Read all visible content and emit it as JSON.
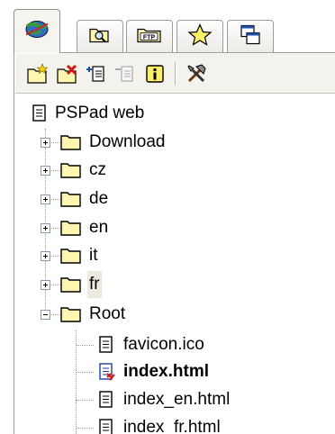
{
  "tabs": [
    {
      "icon": "globe-icon",
      "active": true
    },
    {
      "icon": "folder-search-icon",
      "active": false
    },
    {
      "icon": "ftp-icon",
      "label": "FTP",
      "active": false
    },
    {
      "icon": "star-icon",
      "active": false
    },
    {
      "icon": "windows-icon",
      "active": false
    }
  ],
  "toolbar": {
    "buttons": [
      "new-folder-icon",
      "delete-folder-icon",
      "add-file-icon",
      "remove-file-icon",
      "info-icon",
      "tools-icon"
    ]
  },
  "tree": {
    "root_label": "PSPad web",
    "folders": [
      {
        "label": "Download",
        "expanded": false
      },
      {
        "label": "cz",
        "expanded": false
      },
      {
        "label": "de",
        "expanded": false
      },
      {
        "label": "en",
        "expanded": false
      },
      {
        "label": "it",
        "expanded": false
      },
      {
        "label": "fr",
        "expanded": false,
        "selected": true
      },
      {
        "label": "Root",
        "expanded": true
      }
    ],
    "files": [
      {
        "label": "favicon.ico",
        "bold": false
      },
      {
        "label": "index.html",
        "bold": true
      },
      {
        "label": "index_en.html",
        "bold": false
      },
      {
        "label": "index_fr.html",
        "bold": false
      }
    ]
  },
  "colors": {
    "folder_fill": "#fff7b0",
    "folder_edge": "#000000",
    "toolbar_bg": "#f3f2ec",
    "selection_bg": "#ece9de",
    "accent_red": "#d01818"
  }
}
